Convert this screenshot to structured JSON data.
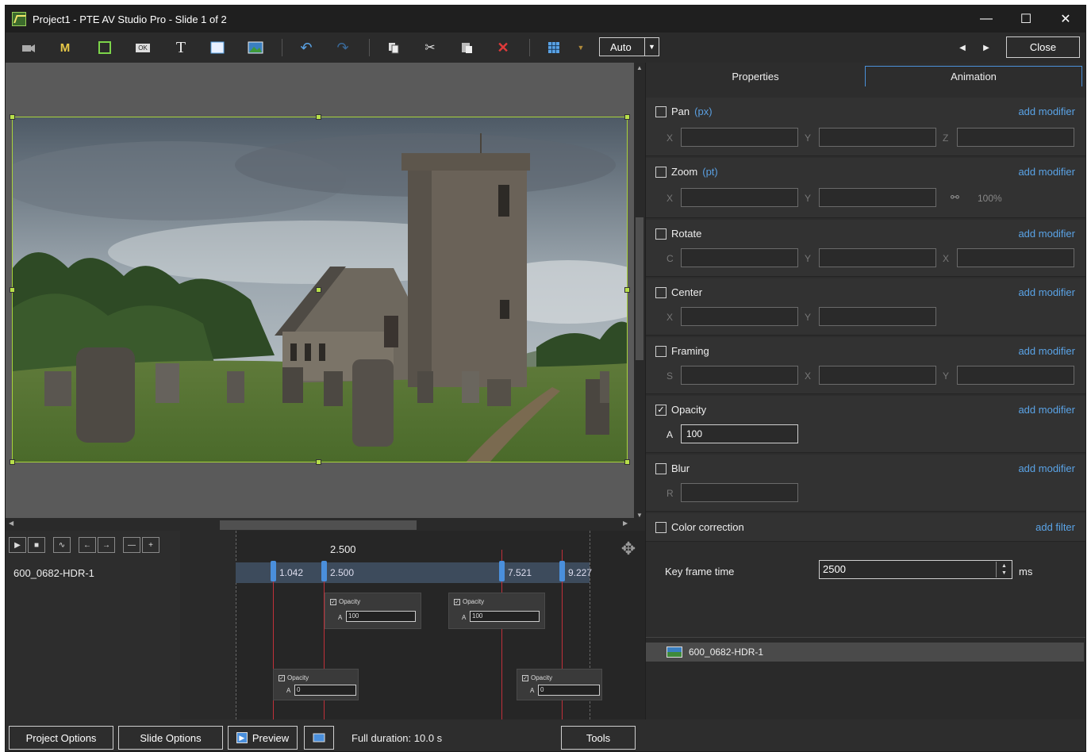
{
  "window": {
    "title": "Project1 - PTE AV Studio Pro - Slide 1 of 2",
    "controls": [
      "—",
      "☐",
      "✕"
    ]
  },
  "toolbar": {
    "tools": [
      "camera-icon",
      "mask-icon",
      "frame-icon",
      "button-icon",
      "text-icon",
      "rectangle-icon",
      "image-icon",
      "undo-icon",
      "redo-icon",
      "copy-icon",
      "cut-icon",
      "paste-icon",
      "delete-icon",
      "grid-icon",
      "grid-dropdown-icon"
    ],
    "mask_label": "M",
    "text_label": "T",
    "button_label": "OK",
    "zoom_value": "Auto",
    "close_label": "Close"
  },
  "timeline": {
    "ruler_time": "2.500",
    "track_name": "600_0682-HDR-1",
    "markers": [
      "1.042",
      "2.500",
      "7.521",
      "9.227"
    ],
    "keyframes": [
      {
        "title": "Opacity",
        "label": "A",
        "value": "100"
      },
      {
        "title": "Opacity",
        "label": "A",
        "value": "100"
      },
      {
        "title": "Opacity",
        "label": "A",
        "value": "0"
      },
      {
        "title": "Opacity",
        "label": "A",
        "value": "0"
      }
    ]
  },
  "bottombar": {
    "project_options": "Project Options",
    "slide_options": "Slide Options",
    "preview": "Preview",
    "duration": "Full duration: 10.0 s",
    "tools": "Tools"
  },
  "panel": {
    "tabs": [
      "Properties",
      "Animation"
    ],
    "active_tab": "Animation",
    "add_modifier": "add modifier",
    "add_filter": "add filter",
    "sections": {
      "pan": {
        "label": "Pan",
        "unit": "(px)",
        "fields": [
          "X",
          "Y",
          "Z"
        ]
      },
      "zoom": {
        "label": "Zoom",
        "unit": "(pt)",
        "fields": [
          "X",
          "Y"
        ],
        "percent": "100%"
      },
      "rotate": {
        "label": "Rotate",
        "fields": [
          "C",
          "Y",
          "X"
        ]
      },
      "center": {
        "label": "Center",
        "fields": [
          "X",
          "Y"
        ]
      },
      "framing": {
        "label": "Framing",
        "fields": [
          "S",
          "X",
          "Y"
        ]
      },
      "opacity": {
        "label": "Opacity",
        "checked": true,
        "field": "A",
        "value": "100"
      },
      "blur": {
        "label": "Blur",
        "field": "R"
      },
      "color": {
        "label": "Color correction"
      }
    },
    "keyframe_time_label": "Key frame time",
    "keyframe_time_value": "2500",
    "keyframe_time_unit": "ms",
    "object_name": "600_0682-HDR-1"
  },
  "colors": {
    "accent": "#4a90d9",
    "selection": "#a8d23b",
    "keyframe_line": "#c0303a",
    "link": "#5aa3e6"
  }
}
